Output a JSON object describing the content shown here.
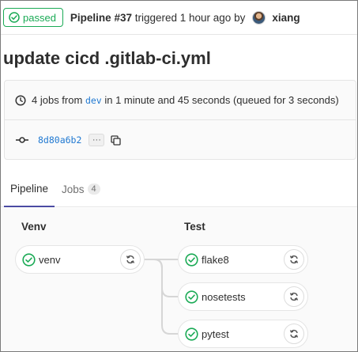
{
  "header": {
    "status_label": "passed",
    "pipeline_label": "Pipeline #37",
    "triggered_text": "triggered 1 hour ago by",
    "author": "xiang"
  },
  "commit_title": "update cicd .gitlab-ci.yml",
  "info": {
    "jobs_count_text": "4 jobs from",
    "branch": "dev",
    "duration_text": "in 1 minute and 45 seconds (queued for 3 seconds)",
    "commit_sha": "8d80a6b2",
    "ellipsis": "···"
  },
  "tabs": [
    {
      "label": "Pipeline",
      "active": true
    },
    {
      "label": "Jobs",
      "count": "4",
      "active": false
    }
  ],
  "stages": [
    {
      "name": "Venv",
      "jobs": [
        {
          "name": "venv",
          "status": "success"
        }
      ]
    },
    {
      "name": "Test",
      "jobs": [
        {
          "name": "flake8",
          "status": "success"
        },
        {
          "name": "nosetests",
          "status": "success"
        },
        {
          "name": "pytest",
          "status": "success"
        }
      ]
    }
  ],
  "colors": {
    "success": "#1aaa55",
    "tab_active": "#4b4ba3",
    "link": "#1f78d1"
  },
  "icons": {
    "status": "check-circle-icon",
    "clock": "clock-icon",
    "commit": "commit-icon",
    "copy": "copy-icon",
    "retry": "retry-icon"
  }
}
